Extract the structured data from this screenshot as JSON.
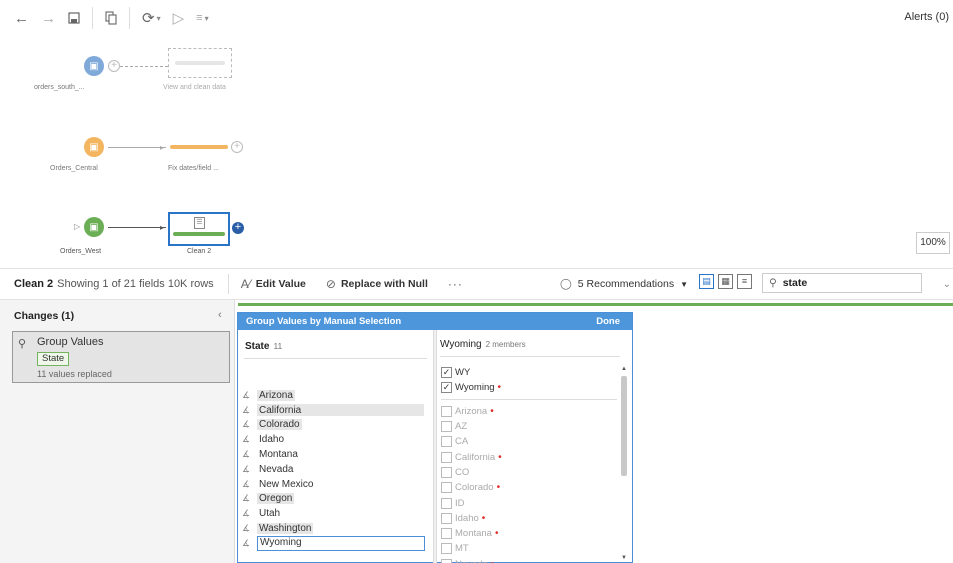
{
  "toolbar": {
    "back_icon": "arrow-left-icon",
    "forward_icon": "arrow-right-icon",
    "save_icon": "save-icon",
    "copy_icon": "copy-icon",
    "refresh_icon": "refresh-icon",
    "run_icon": "run-icon",
    "options_icon": "options-icon",
    "alerts_label": "Alerts (0)"
  },
  "flow": {
    "nodes": [
      {
        "label": "orders_south_...",
        "color": "#7fa9d8",
        "step_label": "View and clean data"
      },
      {
        "label": "Orders_Central",
        "color": "#f3b560",
        "step_label": "Fix dates/field ..."
      },
      {
        "label": "Orders_West",
        "color": "#6bae55",
        "step_label": "Clean 2"
      }
    ],
    "zoom": "100%"
  },
  "profile_bar": {
    "title": "Clean 2",
    "info": "Showing 1 of 21 fields  10K rows",
    "edit_value": "Edit Value",
    "replace_null": "Replace with Null",
    "more": "···",
    "recommendations": "5 Recommendations",
    "search_value": "state"
  },
  "changes": {
    "title": "Changes (1)",
    "card": {
      "title": "Group Values",
      "field": "State",
      "desc": "11 values replaced"
    }
  },
  "dialog": {
    "title": "Group Values by Manual Selection",
    "done": "Done",
    "left": {
      "title": "State",
      "count": "11",
      "values": [
        "Arizona",
        "California",
        "Colorado",
        "Idaho",
        "Montana",
        "Nevada",
        "New Mexico",
        "Oregon",
        "Utah",
        "Washington",
        "Wyoming"
      ]
    },
    "right": {
      "title": "Wyoming",
      "count": "2 members",
      "checked": [
        "WY",
        "Wyoming"
      ],
      "unchecked": [
        "Arizona",
        "AZ",
        "CA",
        "California",
        "CO",
        "Colorado",
        "ID",
        "Idaho",
        "Montana",
        "MT",
        "Nevada"
      ]
    }
  }
}
